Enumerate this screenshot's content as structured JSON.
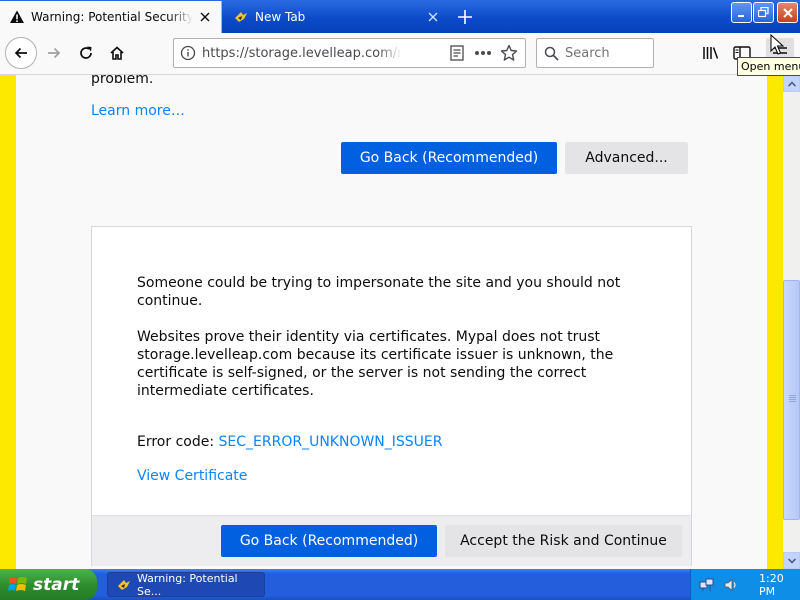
{
  "tabs": [
    {
      "title": "Warning: Potential Security Risk Ahead",
      "icon": "warning-icon",
      "active": true
    },
    {
      "title": "New Tab",
      "icon": "mypal-icon",
      "active": false
    }
  ],
  "nav": {
    "url": "https://storage.levelleap.com/nim",
    "search_placeholder": "Search",
    "menu_tooltip": "Open menu"
  },
  "page": {
    "para_tail": "problem.",
    "learn_more": "Learn more…",
    "go_back_label": "Go Back (Recommended)",
    "advanced_label": "Advanced...",
    "adv_para1": "Someone could be trying to impersonate the site and you should not continue.",
    "adv_para2": "Websites prove their identity via certificates. Mypal does not trust storage.levelleap.com because its certificate issuer is unknown, the certificate is self-signed, or the server is not sending the correct intermediate certificates.",
    "error_code_label": "Error code: ",
    "error_code": "SEC_ERROR_UNKNOWN_ISSUER",
    "view_certificate": "View Certificate",
    "accept_label": "Accept the Risk and Continue"
  },
  "taskbar": {
    "start_label": "start",
    "task_label": "Warning: Potential Se...",
    "clock": "1:20 PM"
  },
  "colors": {
    "accent_blue": "#0060df",
    "link_blue": "#0a84ff",
    "warning_stripe": "#fde800",
    "xp_taskbar": "#245edc"
  }
}
